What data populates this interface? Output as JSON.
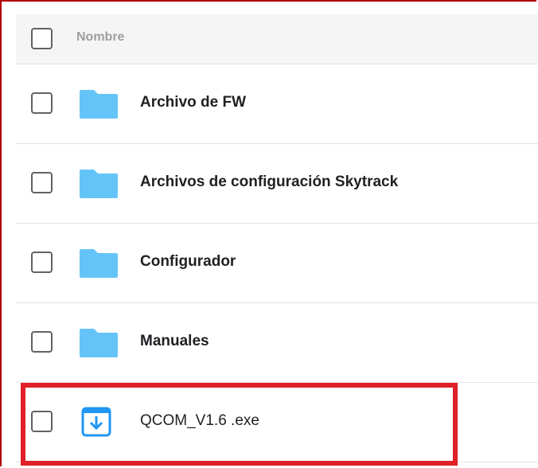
{
  "header": {
    "column_name": "Nombre"
  },
  "items": [
    {
      "name": "Archivo de FW",
      "type": "folder",
      "icon": "folder-icon"
    },
    {
      "name": "Archivos de configuración Skytrack",
      "type": "folder",
      "icon": "folder-icon"
    },
    {
      "name": "Configurador",
      "type": "folder",
      "icon": "folder-icon"
    },
    {
      "name": "Manuales",
      "type": "folder",
      "icon": "folder-icon"
    },
    {
      "name": "QCOM_V1.6 .exe",
      "type": "file",
      "icon": "download-file-icon"
    }
  ],
  "colors": {
    "folder": "#64c4f8",
    "file_icon": "#2196f3",
    "highlight": "#e01f26",
    "frame": "#b30000"
  }
}
